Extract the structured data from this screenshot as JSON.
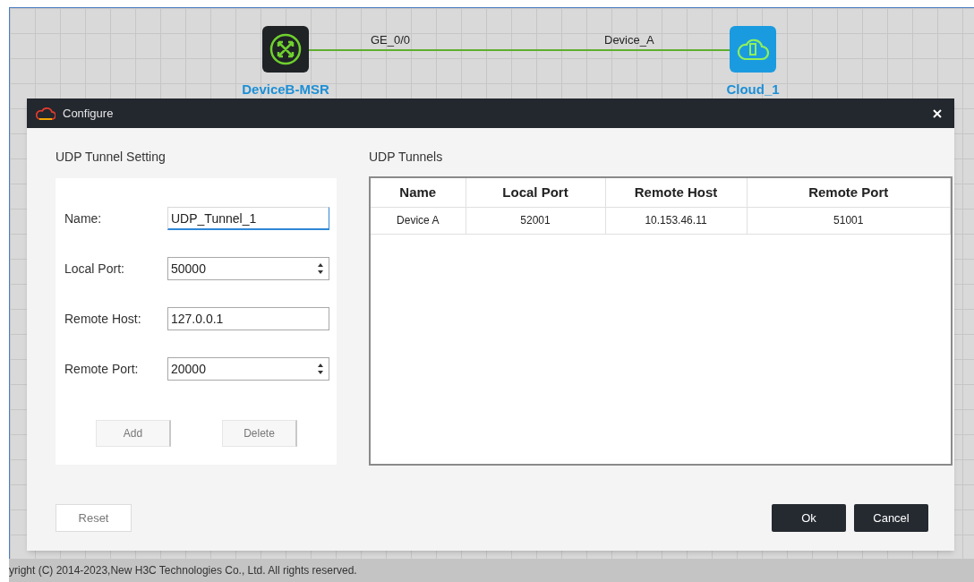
{
  "canvas": {
    "nodes": [
      {
        "kind": "router",
        "label": "DeviceB-MSR"
      },
      {
        "kind": "cloud",
        "label": "Cloud_1"
      }
    ],
    "link": {
      "labels": [
        "GE_0/0",
        "Device_A"
      ]
    }
  },
  "dialog": {
    "title": "Configure",
    "setting": {
      "heading": "UDP Tunnel Setting",
      "fields": [
        {
          "label": "Name:",
          "kind": "text",
          "value": "UDP_Tunnel_1",
          "focused": true
        },
        {
          "label": "Local Port:",
          "kind": "spin",
          "value": "50000",
          "focused": false
        },
        {
          "label": "Remote Host:",
          "kind": "text",
          "value": "127.0.0.1",
          "focused": false
        },
        {
          "label": "Remote Port:",
          "kind": "spin",
          "value": "20000",
          "focused": false
        }
      ],
      "buttons": [
        "Add",
        "Delete"
      ]
    },
    "tunnels": {
      "heading": "UDP Tunnels",
      "columns": [
        "Name",
        "Local Port",
        "Remote Host",
        "Remote Port"
      ],
      "rows": [
        [
          "Device A",
          "52001",
          "10.153.46.11",
          "51001"
        ]
      ]
    },
    "buttons": [
      {
        "label": "Reset",
        "kind": "plain"
      },
      {
        "label": "Ok",
        "kind": "primary"
      },
      {
        "label": "Cancel",
        "kind": "primary"
      }
    ]
  },
  "footer": {
    "copyright": "yright (C) 2014-2023,New H3C Technologies Co., Ltd. All rights reserved."
  }
}
